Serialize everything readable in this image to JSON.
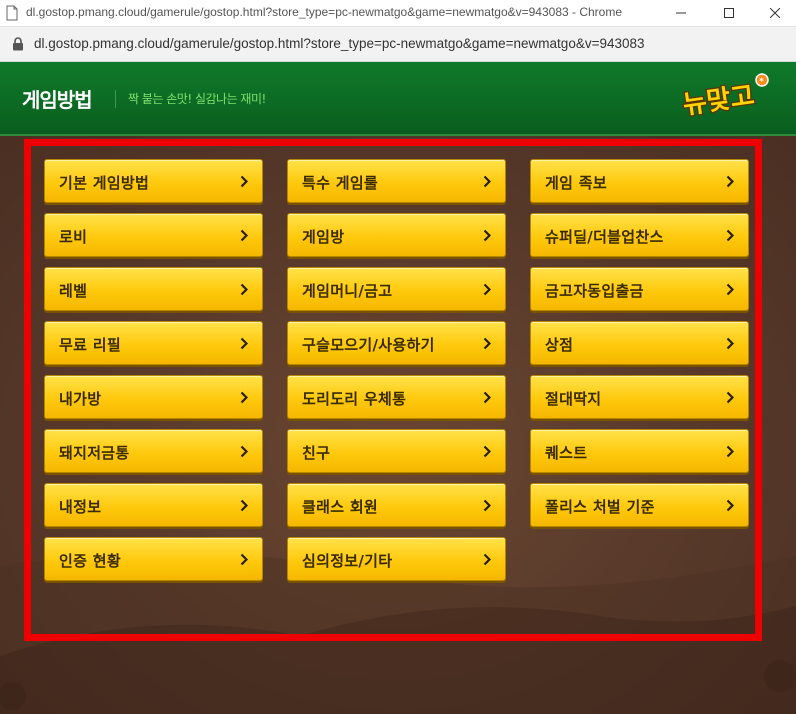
{
  "window": {
    "title": "dl.gostop.pmang.cloud/gamerule/gostop.html?store_type=pc-newmatgo&game=newmatgo&v=943083 - Chrome",
    "url": "dl.gostop.pmang.cloud/gamerule/gostop.html?store_type=pc-newmatgo&game=newmatgo&v=943083"
  },
  "header": {
    "title": "게임방법",
    "slogan": "짝 붙는 손맛! 실감나는 재미!",
    "logo_text": "뉴맞고"
  },
  "colors": {
    "header_green": "#0a5e1f",
    "background_brown": "#57392a",
    "button_yellow": "#ffc90d",
    "highlight_red": "#ee0000"
  },
  "menu": {
    "col1": [
      "기본 게임방법",
      "로비",
      "레벨",
      "무료 리필",
      "내가방",
      "돼지저금통",
      "내정보",
      "인증 현황"
    ],
    "col2": [
      "특수 게임룰",
      "게임방",
      "게임머니/금고",
      "구슬모으기/사용하기",
      "도리도리 우체통",
      "친구",
      "클래스 회원",
      "심의정보/기타"
    ],
    "col3": [
      "게임 족보",
      "슈퍼딜/더블업찬스",
      "금고자동입출금",
      "상점",
      "절대딱지",
      "퀘스트",
      "폴리스 처벌 기준"
    ]
  }
}
